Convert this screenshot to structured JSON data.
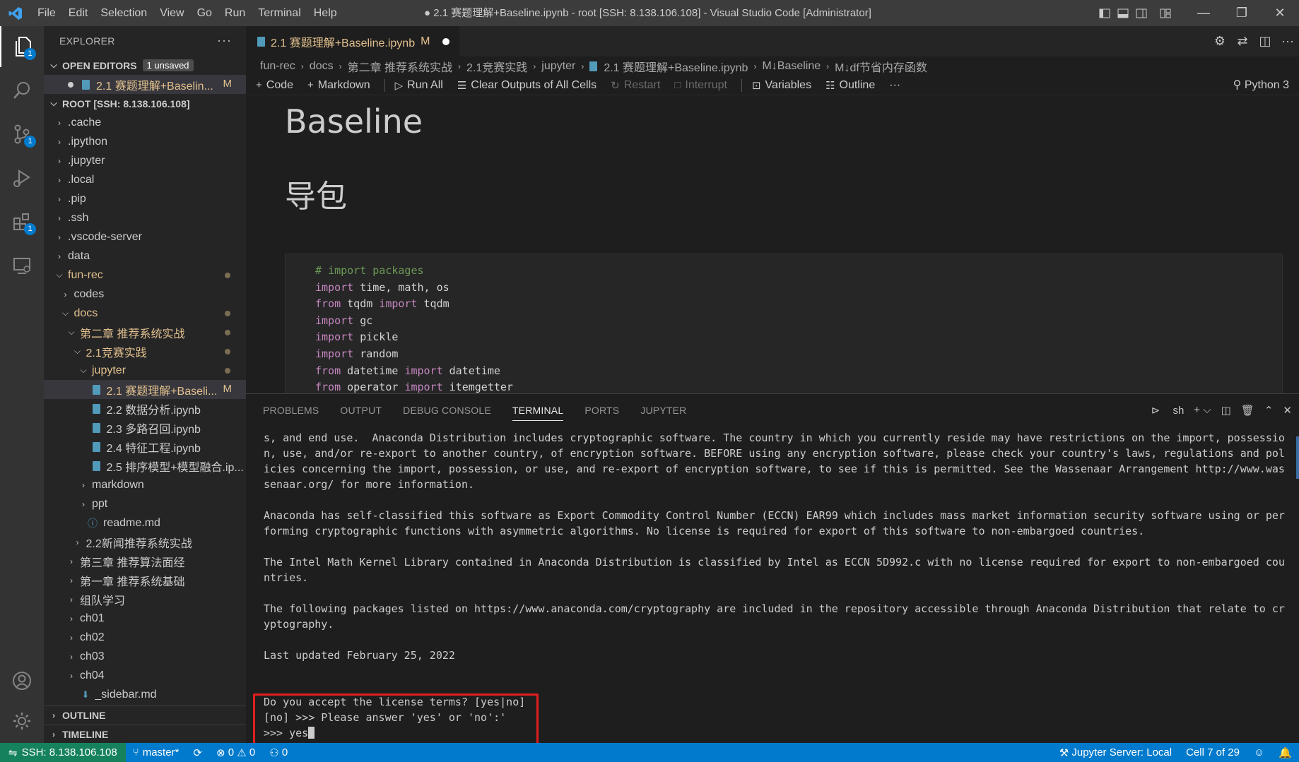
{
  "window": {
    "title": "● 2.1 赛题理解+Baseline.ipynb - root [SSH: 8.138.106.108] - Visual Studio Code [Administrator]",
    "menu": [
      "File",
      "Edit",
      "Selection",
      "View",
      "Go",
      "Run",
      "Terminal",
      "Help"
    ]
  },
  "activity": {
    "explorer_badge": "1",
    "scm_badge": "1",
    "extensions_badge": "1"
  },
  "sidebar": {
    "title": "EXPLORER",
    "open_editors": {
      "label": "OPEN EDITORS",
      "badge": "1 unsaved",
      "item": "2.1 赛题理解+Baselin...",
      "item_status": "M"
    },
    "root_label": "ROOT [SSH: 8.138.106.108]",
    "tree": [
      {
        "label": ".cache"
      },
      {
        "label": ".ipython"
      },
      {
        "label": ".jupyter"
      },
      {
        "label": ".local"
      },
      {
        "label": ".pip"
      },
      {
        "label": ".ssh"
      },
      {
        "label": ".vscode-server"
      },
      {
        "label": "data"
      },
      {
        "label": "fun-rec"
      },
      {
        "label": "codes"
      },
      {
        "label": "docs"
      },
      {
        "label": "第二章 推荐系统实战"
      },
      {
        "label": "2.1竞赛实践"
      },
      {
        "label": "jupyter"
      },
      {
        "label": "2.1 赛题理解+Baseli...",
        "status": "M"
      },
      {
        "label": "2.2 数据分析.ipynb"
      },
      {
        "label": "2.3 多路召回.ipynb"
      },
      {
        "label": "2.4 特征工程.ipynb"
      },
      {
        "label": "2.5 排序模型+模型融合.ip..."
      },
      {
        "label": "markdown"
      },
      {
        "label": "ppt"
      },
      {
        "label": "readme.md"
      },
      {
        "label": "2.2新闻推荐系统实战"
      },
      {
        "label": "第三章 推荐算法面经"
      },
      {
        "label": "第一章 推荐系统基础"
      },
      {
        "label": "组队学习"
      },
      {
        "label": "ch01"
      },
      {
        "label": "ch02"
      },
      {
        "label": "ch03"
      },
      {
        "label": "ch04"
      },
      {
        "label": "_sidebar.md"
      }
    ],
    "outline_label": "OUTLINE",
    "timeline_label": "TIMELINE"
  },
  "editor": {
    "tab": {
      "label": "2.1 赛题理解+Baseline.ipynb",
      "status": "M"
    },
    "breadcrumb": [
      "fun-rec",
      "docs",
      "第二章 推荐系统实战",
      "2.1竞赛实践",
      "jupyter",
      "2.1 赛题理解+Baseline.ipynb",
      "M↓Baseline",
      "M↓df节省内存函数"
    ],
    "toolbar": {
      "code": "Code",
      "markdown": "Markdown",
      "run_all": "Run All",
      "clear": "Clear Outputs of All Cells",
      "restart": "Restart",
      "interrupt": "Interrupt",
      "variables": "Variables",
      "outline": "Outline",
      "kernel": "Python 3"
    },
    "heading1": "Baseline",
    "heading2": "导包",
    "code": {
      "comment": "# import packages",
      "lines": [
        [
          "import",
          " time, math, os"
        ],
        [
          "from",
          " tqdm ",
          "import",
          " tqdm"
        ],
        [
          "import",
          " gc"
        ],
        [
          "import",
          " pickle"
        ],
        [
          "import",
          " random"
        ],
        [
          "from",
          " datetime ",
          "import",
          " datetime"
        ],
        [
          "from",
          " operator ",
          "import",
          " itemgetter"
        ]
      ]
    }
  },
  "panel": {
    "tabs": [
      "PROBLEMS",
      "OUTPUT",
      "DEBUG CONSOLE",
      "TERMINAL",
      "PORTS",
      "JUPYTER"
    ],
    "active_tab": "TERMINAL",
    "shell": "sh",
    "terminal_lines": [
      "s, and end use.  Anaconda Distribution includes cryptographic software. The country in which you currently reside may have restrictions on the import, possessio",
      "n, use, and/or re-export to another country, of encryption software. BEFORE using any encryption software, please check your country's laws, regulations and pol",
      "icies concerning the import, possession, or use, and re-export of encryption software, to see if this is permitted. See the Wassenaar Arrangement http://www.was",
      "senaar.org/ for more information.",
      "",
      "Anaconda has self-classified this software as Export Commodity Control Number (ECCN) EAR99 which includes mass market information security software using or per",
      "forming cryptographic functions with asymmetric algorithms. No license is required for export of this software to non-embargoed countries.",
      "",
      "The Intel Math Kernel Library contained in Anaconda Distribution is classified by Intel as ECCN 5D992.c with no license required for export to non-embargoed cou",
      "ntries.",
      "",
      "The following packages listed on https://www.anaconda.com/cryptography are included in the repository accessible through Anaconda Distribution that relate to cr",
      "yptography.",
      "",
      "Last updated February 25, 2022",
      "",
      "",
      "Do you accept the license terms? [yes|no]",
      "[no] >>> Please answer 'yes' or 'no':'",
      ">>> yes"
    ]
  },
  "status": {
    "remote": "SSH: 8.138.106.108",
    "branch": "master*",
    "errors": "0",
    "warnings": "0",
    "ports": "0",
    "jupyter": "Jupyter Server: Local",
    "cell": "Cell 7 of 29"
  },
  "colors": {
    "accent": "#007acc",
    "remote": "#16825d",
    "highlight_box": "#e01e1e",
    "modified": "#e2c08d"
  }
}
